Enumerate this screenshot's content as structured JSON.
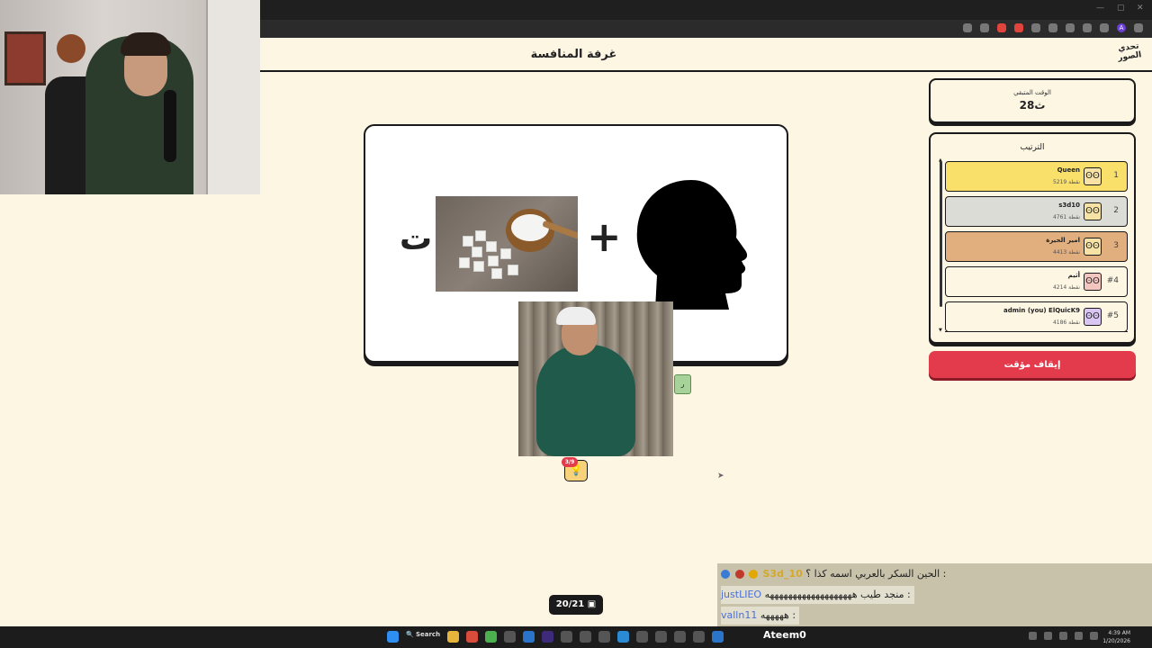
{
  "header": {
    "page_title": "غرفة المنافسة",
    "logo_text": "تحدي الصور"
  },
  "timer": {
    "label": "الوقت المتبقي",
    "value": "28ث"
  },
  "ranking": {
    "title": "الترتيب",
    "rows": [
      {
        "pos": "1",
        "name": "Queen",
        "points": "5219 نقطة",
        "bg": "#f9e06a"
      },
      {
        "pos": "2",
        "name": "s3d10",
        "points": "4761 نقطة",
        "bg": "#dcdcd6"
      },
      {
        "pos": "3",
        "name": "امير الحيرة",
        "points": "4413 نقطة",
        "bg": "#e1ae7e"
      },
      {
        "pos": "#4",
        "name": "أثيم",
        "points": "4214 نقطة",
        "bg": "#fdf6e3"
      },
      {
        "pos": "#5",
        "name": "admin  (you) ElQuicK9",
        "points": "4186 نقطة",
        "bg": "#fdf6e3"
      }
    ]
  },
  "stop_button": "إيقاف مؤقت",
  "puzzle": {
    "letter": "ت",
    "plus": "+"
  },
  "hint": {
    "badge": "3/9",
    "tag": "ر"
  },
  "progress": "20/21",
  "chat": [
    {
      "user": "S3d_10",
      "message": "الحين السكر بالعربي اسمه كذا ؟ :"
    },
    {
      "user": "justLIEO",
      "message": "منجد طيب هههههههههههههههههههه :"
    },
    {
      "user": "valln11",
      "message": "هههههه :"
    }
  ],
  "taskbar": {
    "search": "Search",
    "streamer": "Ateem0",
    "time": "4:39 AM",
    "date": "1/20/2026"
  },
  "colors": {
    "background": "#fdf6e3",
    "stop_button": "#e33b4b",
    "first_place": "#f9e06a",
    "third_place": "#e1ae7e"
  }
}
